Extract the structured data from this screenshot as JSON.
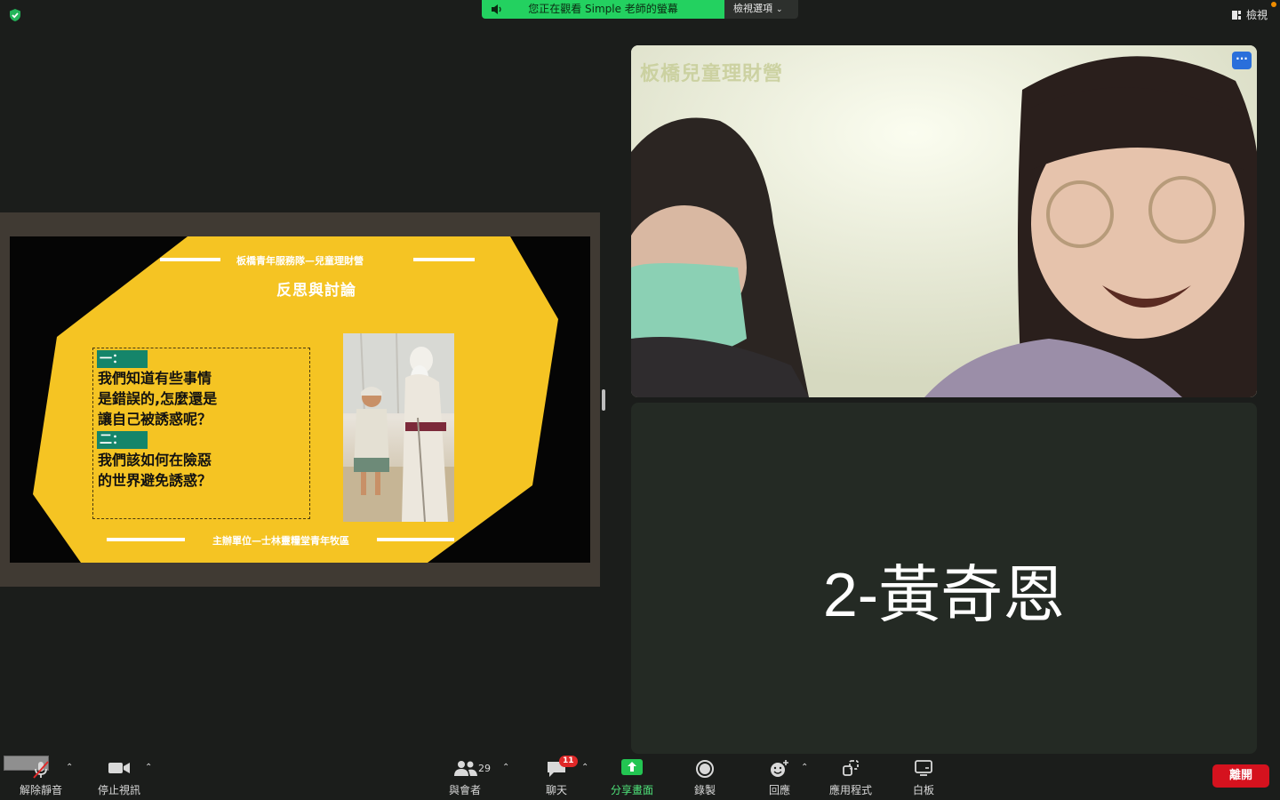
{
  "topbar": {
    "share_banner_text": "您正在觀看 Simple 老師的螢幕",
    "view_options_label": "檢視選項",
    "view_label": "檢視"
  },
  "slide": {
    "header": "板橋青年服務隊—兒童理財營",
    "title": "反思與討論",
    "q1_tag": "一：",
    "q1_line1": "我們知道有些事情",
    "q1_line2": "是錯誤的,怎麼還是",
    "q1_line3": "讓自己被誘惑呢？",
    "q2_tag": "二：",
    "q2_line1": "我們該如何在險惡",
    "q2_line2": "的世界避免誘惑？",
    "footer": "主辦單位—士林靈糧堂青年牧區",
    "colors": {
      "yellow": "#f5c423",
      "teal": "#15856a"
    }
  },
  "video": {
    "watermark": "板橋兒童理財營",
    "more_label": "···"
  },
  "participant_tile": {
    "name": "2-黃奇恩"
  },
  "toolbar": {
    "unmute": "解除靜音",
    "stop_video": "停止視訊",
    "participants": "與會者",
    "participants_count": "29",
    "chat": "聊天",
    "chat_badge": "11",
    "share": "分享畫面",
    "record": "錄製",
    "reactions": "回應",
    "apps": "應用程式",
    "whiteboard": "白板",
    "leave": "離開"
  }
}
